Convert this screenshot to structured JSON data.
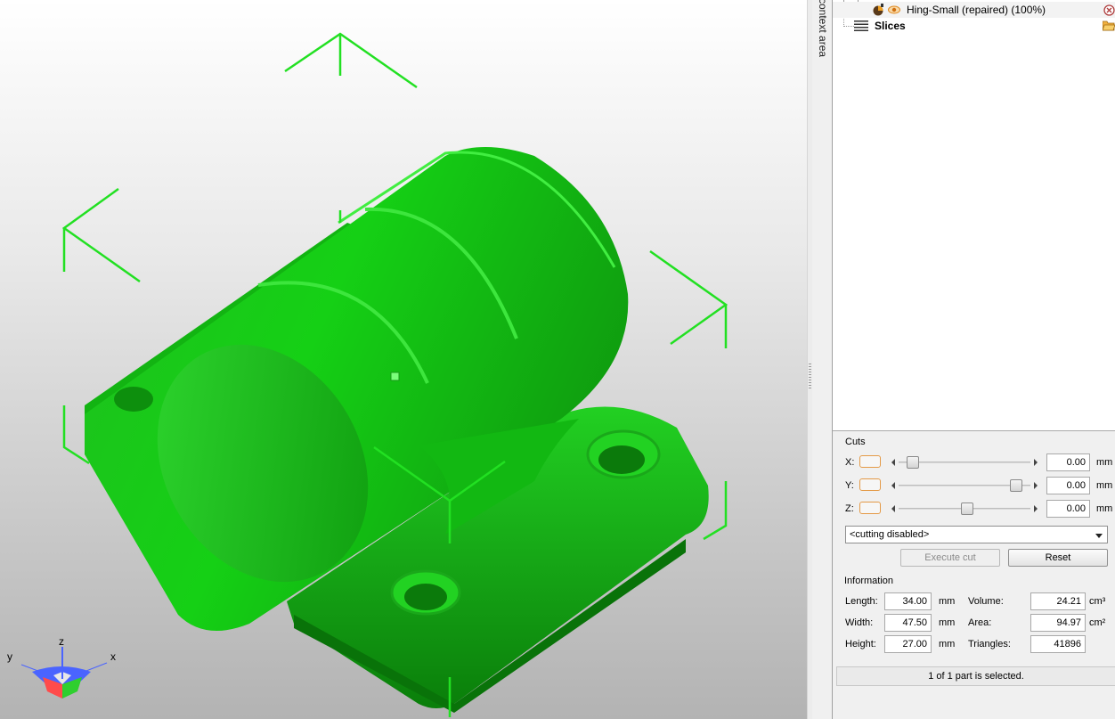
{
  "viewport": {
    "model_color": "#10d010",
    "bounds_color": "#22e022",
    "axis_gizmo": {
      "x_label": "x",
      "y_label": "y",
      "z_label": "z"
    }
  },
  "side_tab": {
    "label": "context area"
  },
  "tree": {
    "items": [
      {
        "label": "Hing-Small (repaired) (100%)",
        "icon": "part-icon",
        "action_icon": "close-icon"
      },
      {
        "label": "Slices",
        "icon": "slices-icon",
        "action_icon": "folder-icon"
      }
    ]
  },
  "cuts": {
    "title": "Cuts",
    "axes": [
      {
        "label": "X:",
        "value": "0.00",
        "unit": "mm",
        "slider_position": 0.07
      },
      {
        "label": "Y:",
        "value": "0.00",
        "unit": "mm",
        "slider_position": 0.93
      },
      {
        "label": "Z:",
        "value": "0.00",
        "unit": "mm",
        "slider_position": 0.52
      }
    ],
    "mode_select": "<cutting disabled>",
    "execute_label": "Execute cut",
    "reset_label": "Reset"
  },
  "information": {
    "title": "Information",
    "length_label": "Length:",
    "length_value": "34.00",
    "length_unit": "mm",
    "width_label": "Width:",
    "width_value": "47.50",
    "width_unit": "mm",
    "height_label": "Height:",
    "height_value": "27.00",
    "height_unit": "mm",
    "volume_label": "Volume:",
    "volume_value": "24.21",
    "volume_unit": "cm³",
    "area_label": "Area:",
    "area_value": "94.97",
    "area_unit": "cm²",
    "triangles_label": "Triangles:",
    "triangles_value": "41896"
  },
  "status": {
    "text": "1 of 1 part is selected."
  }
}
